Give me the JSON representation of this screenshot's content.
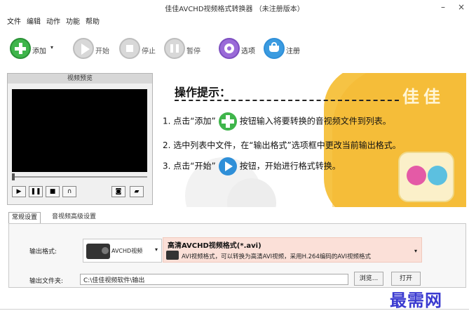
{
  "window": {
    "title": "佳佳AVCHD视频格式转换器  （未注册版本）",
    "minimize": "–",
    "close": "×"
  },
  "menu": [
    "文件",
    "编辑",
    "动作",
    "功能",
    "帮助"
  ],
  "toolbar": {
    "add": "添加",
    "start": "开始",
    "stop": "停止",
    "pause": "暂停",
    "options": "选项",
    "register": "注册"
  },
  "preview": {
    "header": "视频预览"
  },
  "tips": {
    "title": "操作提示：",
    "brand": "佳佳",
    "line1_a": "1. 点击“添加”",
    "line1_b": "按钮输入将要转换的音视频文件到列表。",
    "line2": "2. 选中列表中文件，在“输出格式”选项框中更改当前输出格式。",
    "line3_a": "3. 点击“开始”",
    "line3_b": "按钮，开始进行格式转换。"
  },
  "tabs": {
    "general": "常规设置",
    "advanced": "音视频高级设置"
  },
  "settings": {
    "format_label": "输出格式:",
    "format_category": "AVCHD视频",
    "format_name": "高清AVCHD视频格式(*.avi)",
    "format_desc": "AVI视频格式，可以转换为高清AVI视频，采用H.264编码的AVI视频格式",
    "folder_label": "输出文件夹:",
    "folder_value": "C:\\佳佳视频软件\\输出",
    "browse": "浏览...",
    "open": "打开"
  },
  "watermark": "最需网",
  "colors": {
    "accent_green": "#3fb54b",
    "accent_blue": "#2f8fd8",
    "tips_yellow": "#f6c344"
  }
}
